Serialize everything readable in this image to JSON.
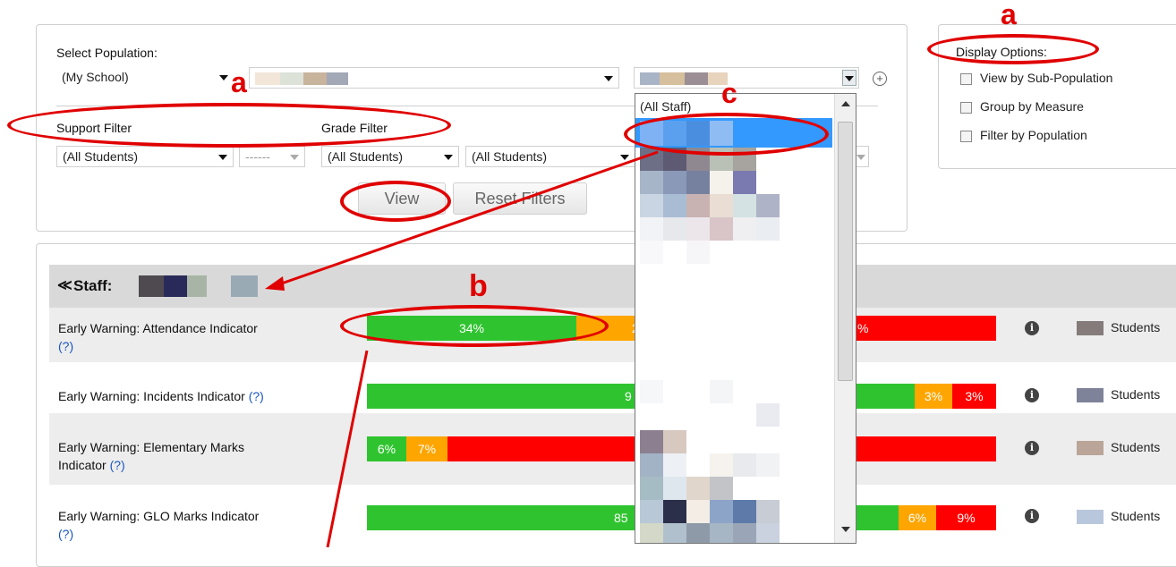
{
  "filters": {
    "select_population_label": "Select Population:",
    "school_value": "(My School)",
    "support_filter_label": "Support Filter",
    "support_value": "(All Students)",
    "support_secondary_value": "------",
    "grade_filter_label": "Grade Filter",
    "grade_value_1": "(All Students)",
    "grade_value_2": "(All Students)",
    "view_button": "View",
    "reset_button": "Reset Filters"
  },
  "display_options": {
    "title": "Display Options:",
    "options": [
      "View by Sub-Population",
      "Group by Measure",
      "Filter by Population"
    ]
  },
  "staff_dropdown": {
    "first_option": "(All Staff)"
  },
  "staff_header": {
    "label": "Staff:"
  },
  "measures": [
    {
      "name_line1": "Early Warning: Attendance Indicator",
      "name_line2": "",
      "help": "(?)",
      "segments": [
        {
          "color": "green",
          "label": "34%"
        },
        {
          "color": "orange",
          "label": "2"
        },
        {
          "color": "red",
          "label": "%"
        }
      ],
      "students_label": "Students"
    },
    {
      "name_line1": "Early Warning: Incidents Indicator",
      "name_line2": "",
      "help": "(?)",
      "segments": [
        {
          "color": "green",
          "label": "9"
        },
        {
          "color": "orange",
          "label": "3%"
        },
        {
          "color": "red",
          "label": "3%"
        }
      ],
      "students_label": "Students"
    },
    {
      "name_line1": "Early Warning: Elementary Marks",
      "name_line2": "Indicator",
      "help": "(?)",
      "segments": [
        {
          "color": "green",
          "label": "6%"
        },
        {
          "color": "orange",
          "label": "7%"
        },
        {
          "color": "red",
          "label": ""
        }
      ],
      "students_label": "Students"
    },
    {
      "name_line1": "Early Warning: GLO Marks Indicator",
      "name_line2": "",
      "help": "(?)",
      "segments": [
        {
          "color": "green",
          "label": "85"
        },
        {
          "color": "orange",
          "label": "6%"
        },
        {
          "color": "red",
          "label": "9%"
        }
      ],
      "students_label": "Students"
    }
  ],
  "annotations": {
    "a": "a",
    "b": "b",
    "c": "c"
  },
  "colors": {
    "green": "#2fc42f",
    "orange": "#ffa500",
    "red": "#ff0000",
    "annotation": "#e00000"
  }
}
